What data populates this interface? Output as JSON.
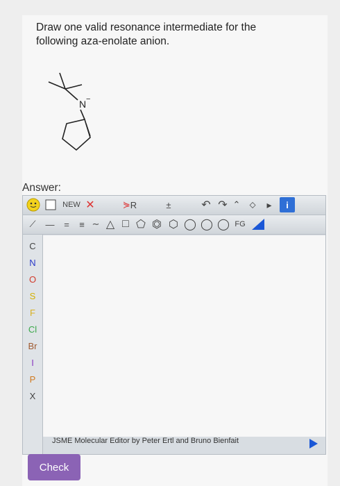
{
  "question": {
    "text_line1": "Draw one valid resonance intermediate for the",
    "text_line2": "following aza-enolate anion.",
    "molecule_label": "N"
  },
  "answer_label": "Answer:",
  "editor": {
    "toolbar1": {
      "new_label": "NEW",
      "r_label": "R",
      "fraction_label": "±"
    },
    "toolbar2": {
      "fg_label": "FG"
    },
    "elements": [
      "C",
      "N",
      "O",
      "S",
      "F",
      "Cl",
      "Br",
      "I",
      "P",
      "X"
    ],
    "element_colors": [
      "#444444",
      "#2b3ac8",
      "#d23a2a",
      "#d4b000",
      "#d8b020",
      "#3aa84a",
      "#a05a30",
      "#8a3ac0",
      "#d07a20",
      "#444444"
    ],
    "credit": "JSME Molecular Editor by Peter Ertl and Bruno Bienfait"
  },
  "check_button": "Check"
}
